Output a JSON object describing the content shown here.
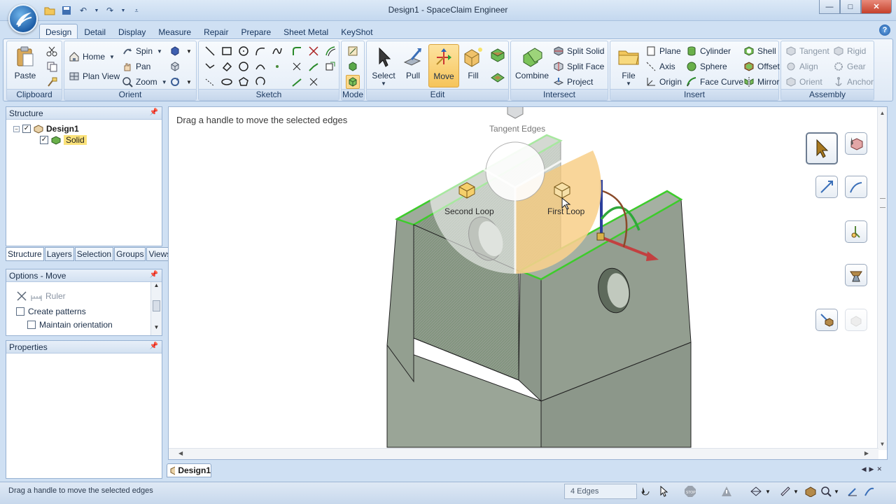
{
  "window": {
    "title": "Design1 - SpaceClaim Engineer",
    "minimize": "—",
    "maximize": "□",
    "close": "✕"
  },
  "ribbon_tabs": [
    "Design",
    "Detail",
    "Display",
    "Measure",
    "Repair",
    "Prepare",
    "Sheet Metal",
    "KeyShot"
  ],
  "ribbon": {
    "clipboard": {
      "label": "Clipboard",
      "paste": "Paste"
    },
    "orient": {
      "label": "Orient",
      "home": "Home",
      "plan_view": "Plan View",
      "spin": "Spin",
      "pan": "Pan",
      "zoom": "Zoom"
    },
    "sketch": {
      "label": "Sketch"
    },
    "mode": {
      "label": "Mode"
    },
    "edit": {
      "label": "Edit",
      "select": "Select",
      "pull": "Pull",
      "move": "Move",
      "fill": "Fill"
    },
    "intersect": {
      "label": "Intersect",
      "combine": "Combine",
      "split_solid": "Split Solid",
      "split_face": "Split Face",
      "project": "Project"
    },
    "insert": {
      "label": "Insert",
      "file": "File",
      "plane": "Plane",
      "axis": "Axis",
      "origin": "Origin",
      "cylinder": "Cylinder",
      "sphere": "Sphere",
      "face_curve": "Face Curve",
      "shell": "Shell",
      "offset": "Offset",
      "mirror": "Mirror"
    },
    "assembly": {
      "label": "Assembly",
      "tangent": "Tangent",
      "align": "Align",
      "orient": "Orient",
      "rigid": "Rigid",
      "gear": "Gear",
      "anchor": "Anchor"
    }
  },
  "structure": {
    "title": "Structure",
    "root": "Design1",
    "child": "Solid",
    "tabs": [
      "Structure",
      "Layers",
      "Selection",
      "Groups",
      "Views"
    ]
  },
  "options": {
    "title": "Options - Move",
    "ruler": "Ruler",
    "create_patterns": "Create patterns",
    "maintain_orientation": "Maintain orientation"
  },
  "properties": {
    "title": "Properties"
  },
  "viewport": {
    "hint": "Drag a handle to move the selected edges",
    "ring": {
      "top": "Tangent Edges",
      "left": "Second Loop",
      "right": "First Loop"
    }
  },
  "document_tab": "Design1",
  "status": {
    "text": "Drag a handle to move the selected edges",
    "count": "4 Edges"
  },
  "colors": {
    "accent": "#f6c45a",
    "selection_green": "#3dcc2b",
    "solid_gray": "#8e9a8b"
  }
}
